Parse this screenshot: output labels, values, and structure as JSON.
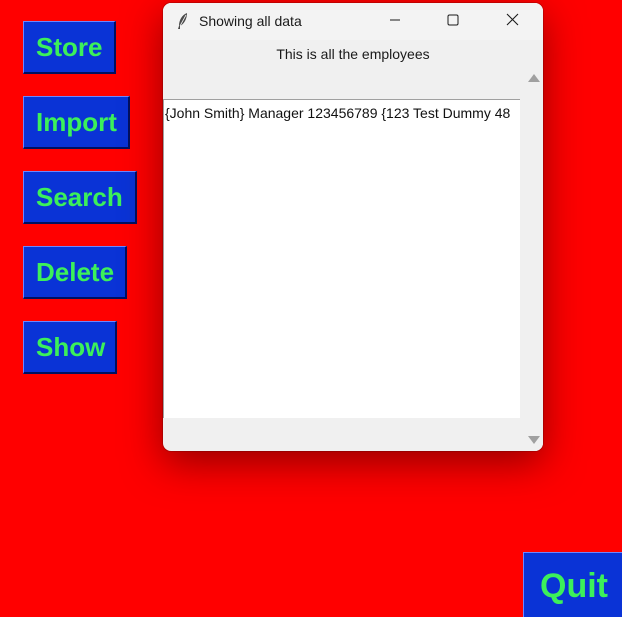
{
  "main": {
    "buttons": {
      "store": "Store",
      "import": "Import",
      "search": "Search",
      "delete": "Delete",
      "show": "Show",
      "quit": "Quit"
    },
    "colors": {
      "background": "#ff0000",
      "button_bg": "#0a33d6",
      "button_text": "#3cf05a"
    }
  },
  "dialog": {
    "title": "Showing all data",
    "heading": "This is all the employees",
    "icon": "feather-icon",
    "controls": [
      "minimize-icon",
      "maximize-icon",
      "close-icon"
    ],
    "list_items": [
      "{John Smith} Manager 123456789 {123 Test Dummy 48"
    ]
  }
}
